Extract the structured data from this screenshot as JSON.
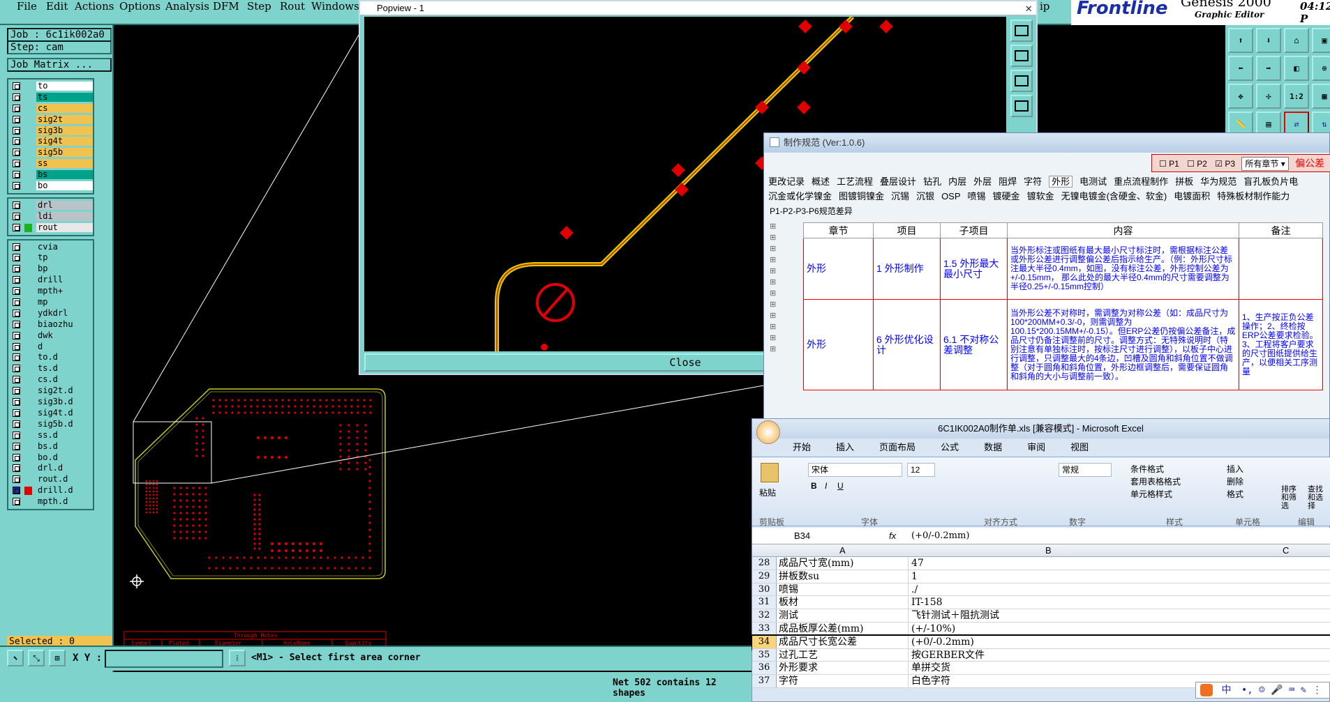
{
  "menubar": {
    "items": [
      "File",
      "Edit",
      "Actions",
      "Options",
      "Analysis",
      "DFM",
      "Step",
      "Rout",
      "Windows"
    ],
    "help": "ip",
    "brand": "Frontline",
    "product": "Genesis 2000",
    "subtitle": "Graphic Editor",
    "clock": "04:12 P"
  },
  "job_panel": {
    "job": "Job : 6c1ik002a0",
    "step": "Step: cam",
    "matrix_button": "Job Matrix ..."
  },
  "layers": {
    "group1": [
      {
        "name": "to",
        "color": "#ffffff"
      },
      {
        "name": "ts",
        "color": "#00a38a"
      },
      {
        "name": "cs",
        "color": "#f2c24e"
      },
      {
        "name": "sig2t",
        "color": "#f2c24e"
      },
      {
        "name": "sig3b",
        "color": "#f2c24e"
      },
      {
        "name": "sig4t",
        "color": "#f2c24e"
      },
      {
        "name": "sig5b",
        "color": "#f2c24e"
      },
      {
        "name": "ss",
        "color": "#f2c24e"
      },
      {
        "name": "bs",
        "color": "#00a38a"
      },
      {
        "name": "bo",
        "color": "#ffffff"
      }
    ],
    "group2": [
      {
        "name": "drl",
        "color": "#b8c4c8"
      },
      {
        "name": "ldi",
        "color": "#b8c4c8"
      },
      {
        "name": "rout",
        "color": "#e8e8e8",
        "swatch": "#1eb01e"
      }
    ],
    "group3": [
      {
        "name": "cvia",
        "color": "#7ed3cc"
      },
      {
        "name": "tp",
        "color": "#7ed3cc"
      },
      {
        "name": "bp",
        "color": "#7ed3cc"
      },
      {
        "name": "drill",
        "color": "#7ed3cc"
      },
      {
        "name": "mpth+",
        "color": "#7ed3cc"
      },
      {
        "name": "mp",
        "color": "#7ed3cc"
      },
      {
        "name": "ydkdrl",
        "color": "#7ed3cc"
      },
      {
        "name": "biaozhu",
        "color": "#7ed3cc"
      },
      {
        "name": "dwk",
        "color": "#7ed3cc"
      },
      {
        "name": "d",
        "color": "#7ed3cc"
      },
      {
        "name": "to.d",
        "color": "#7ed3cc"
      },
      {
        "name": "ts.d",
        "color": "#7ed3cc"
      },
      {
        "name": "cs.d",
        "color": "#7ed3cc"
      },
      {
        "name": "sig2t.d",
        "color": "#7ed3cc"
      },
      {
        "name": "sig3b.d",
        "color": "#7ed3cc"
      },
      {
        "name": "sig4t.d",
        "color": "#7ed3cc"
      },
      {
        "name": "sig5b.d",
        "color": "#7ed3cc"
      },
      {
        "name": "ss.d",
        "color": "#7ed3cc"
      },
      {
        "name": "bs.d",
        "color": "#7ed3cc"
      },
      {
        "name": "bo.d",
        "color": "#7ed3cc"
      },
      {
        "name": "drl.d",
        "color": "#7ed3cc"
      },
      {
        "name": "rout.d",
        "color": "#7ed3cc"
      },
      {
        "name": "drill.d",
        "color": "#7ed3cc",
        "swatch": "#e00000",
        "active": true
      },
      {
        "name": "mpth.d",
        "color": "#7ed3cc"
      }
    ],
    "selected": "Selected : 0"
  },
  "popview": {
    "title": "Popview - 1",
    "close": "Close"
  },
  "drill_table": {
    "title": "Through Holes",
    "headers": [
      "Symbol",
      "Plated",
      "Diameter",
      "HoleNome",
      "Quantity"
    ]
  },
  "bottom": {
    "xy_label": "X Y :",
    "prompt": "<M1> - Select first area corner",
    "status": "Net 502 contains 12 shapes"
  },
  "spec": {
    "title": "制作规范 (Ver:1.0.6)",
    "checks": [
      "P1",
      "P2",
      "P3"
    ],
    "section_select": "所有章节",
    "tolerance_tag": "偏公差",
    "tabs1": [
      "更改记录",
      "概述",
      "工艺流程",
      "叠层设计",
      "钻孔",
      "内层",
      "外层",
      "阻焊",
      "字符",
      "外形",
      "电测试",
      "重点流程制作",
      "拼板",
      "华为规范",
      "盲孔板负片电"
    ],
    "tabs2": [
      "沉金或化学镍金",
      "图镀铜镍金",
      "沉锡",
      "沉银",
      "OSP",
      "喷锡",
      "镀硬金",
      "镀软金",
      "无镍电镀金(含硬金、软金)",
      "电镀面积",
      "特殊板材制作能力"
    ],
    "subtab": "P1-P2-P3-P6规范差异",
    "headers": [
      "章节",
      "项目",
      "子项目",
      "内容",
      "备注"
    ],
    "rows": [
      {
        "chapter": "外形",
        "item": "1 外形制作",
        "subitem": "1.5 外形最大最小尺寸",
        "content": "当外形标注或图纸有最大最小尺寸标注时，需根据标注公差或外形公差进行调整偏公差后指示给生产。（例：外形尺寸标注最大半径0.4mm，如图，没有标注公差，外形控制公差为+/-0.15mm， 那么此处的最大半径0.4mm的尺寸需要调整为半径0.25+/-0.15mm控制）",
        "note": ""
      },
      {
        "chapter": "外形",
        "item": "6 外形优化设计",
        "subitem": "6.1 不对称公差调整",
        "content": "当外形公差不对称时，需调整为对称公差（如：成品尺寸为100*200MM+0.3/-0，则需调整为100.15*200.15MM+/-0.15）。但ERP公差仍按偏公差备注，成品尺寸仍备注调整前的尺寸。调整方式：无特殊说明时（特别注意有单独标注时，按标注尺寸进行调整），以板子中心进行调整，只调整最大的4条边，凹槽及圆角和斜角位置不做调整（对于圆角和斜角位置，外形边框调整后，需要保证圆角和斜角的大小与调整前一致）。",
        "note": "1、生产按正负公差操作；2、终检按ERP公差要求检验。3、工程将客户要求的尺寸图纸提供给生产，以便相关工序测量"
      }
    ]
  },
  "excel": {
    "title": "6C1IK002A0制作单.xls  [兼容模式] - Microsoft Excel",
    "tabs": [
      "开始",
      "插入",
      "页面布局",
      "公式",
      "数据",
      "审阅",
      "视图"
    ],
    "font_name": "宋体",
    "font_size": "12",
    "number_format": "常规",
    "paste": "粘贴",
    "group_labels": [
      "剪贴板",
      "字体",
      "对齐方式",
      "数字",
      "样式",
      "单元格",
      "编辑"
    ],
    "style_items": [
      "条件格式",
      "套用表格格式",
      "单元格样式"
    ],
    "cell_items": [
      "插入",
      "删除",
      "格式"
    ],
    "edit_items": [
      "排序和筛选",
      "查找和选择"
    ],
    "name_box": "B34",
    "formula": "(+0/-0.2mm)",
    "columns": [
      "A",
      "B",
      "C"
    ],
    "rows": [
      {
        "num": "28",
        "a": "成品尺寸宽(mm)",
        "b": "47"
      },
      {
        "num": "29",
        "a": "拼板数su",
        "b": "1"
      },
      {
        "num": "30",
        "a": "喷锡",
        "b": "./"
      },
      {
        "num": "31",
        "a": "板材",
        "b": "IT-158"
      },
      {
        "num": "32",
        "a": "测试",
        "b": "飞针测试＋阻抗测试"
      },
      {
        "num": "33",
        "a": "成品板厚公差(mm)",
        "b": "(+/-10%)"
      },
      {
        "num": "34",
        "a": "成品尺寸长宽公差",
        "b": "(+0/-0.2mm)"
      },
      {
        "num": "35",
        "a": "过孔工艺",
        "b": "按GERBER文件"
      },
      {
        "num": "36",
        "a": "外形要求",
        "b": "单拼交货"
      },
      {
        "num": "37",
        "a": "字符",
        "b": "白色字符"
      }
    ]
  },
  "ime": {
    "label": "中"
  }
}
